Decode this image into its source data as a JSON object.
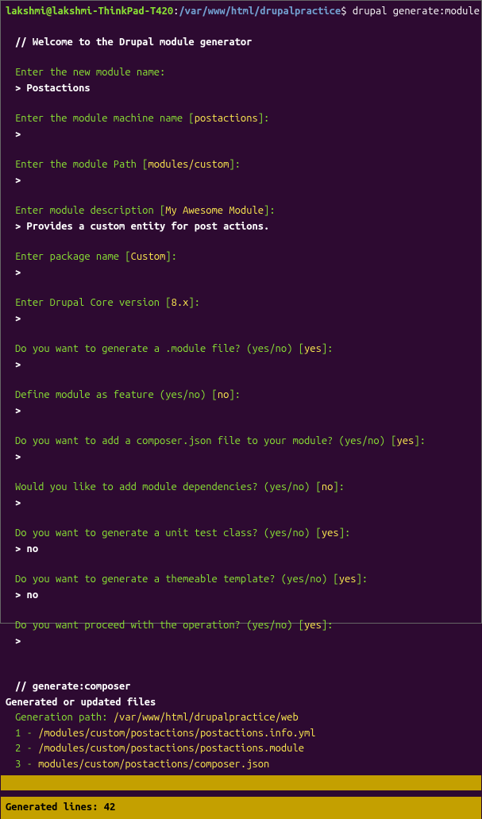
{
  "prompt": {
    "userhost": "lakshmi@lakshmi-ThinkPad-T420",
    "colon": ":",
    "path": "/var/www/html/drupalpractice",
    "dollar": "$ ",
    "command": "drupal generate:module"
  },
  "welcome": "// Welcome to the Drupal module generator",
  "q1": {
    "label": "Enter the new module name:",
    "answer": "> Postactions"
  },
  "q2": {
    "pre": "Enter the module machine name [",
    "def": "postactions",
    "post": "]:",
    "answer": ">"
  },
  "q3": {
    "pre": "Enter the module Path [",
    "def": "modules/custom",
    "post": "]:",
    "answer": ">"
  },
  "q4": {
    "pre": "Enter module description [",
    "def": "My Awesome Module",
    "post": "]:",
    "answer": "> Provides a custom entity for post actions."
  },
  "q5": {
    "pre": "Enter package name [",
    "def": "Custom",
    "post": "]:",
    "answer": ">"
  },
  "q6": {
    "pre": "Enter Drupal Core version [",
    "def": "8.x",
    "post": "]:",
    "answer": ">"
  },
  "q7": {
    "pre": "Do you want to generate a .module file? (yes/no) [",
    "def": "yes",
    "post": "]:",
    "answer": ">"
  },
  "q8": {
    "pre": "Define module as feature (yes/no) [",
    "def": "no",
    "post": "]:",
    "answer": ">"
  },
  "q9": {
    "pre": "Do you want to add a composer.json file to your module? (yes/no) [",
    "def": "yes",
    "post": "]:",
    "answer": ">"
  },
  "q10": {
    "pre": "Would you like to add module dependencies? (yes/no) [",
    "def": "no",
    "post": "]:",
    "answer": ">"
  },
  "q11": {
    "pre": "Do you want to generate a unit test class? (yes/no) [",
    "def": "yes",
    "post": "]:",
    "answer": "> no"
  },
  "q12": {
    "pre": "Do you want to generate a themeable template? (yes/no) [",
    "def": "yes",
    "post": "]:",
    "answer": "> no"
  },
  "q13": {
    "pre": "Do you want proceed with the operation? (yes/no) [",
    "def": "yes",
    "post": "]:",
    "answer": ">"
  },
  "gen": {
    "comment": "// generate:composer",
    "updated": "Generated or updated files",
    "genpath_label": "Generation path: ",
    "genpath_value": "/var/www/html/drupalpractice/web",
    "f1n": "1 - ",
    "f1": "/modules/custom/postactions/postactions.info.yml",
    "f2n": "2 - ",
    "f2": "/modules/custom/postactions/postactions.module",
    "f3n": "3 - ",
    "f3": "modules/custom/postactions/composer.json"
  },
  "footer": "Generated lines: 42"
}
